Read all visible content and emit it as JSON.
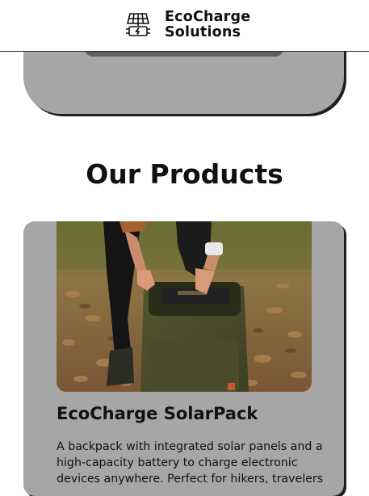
{
  "header": {
    "brand_line1": "EcoCharge",
    "brand_line2": "Solutions",
    "logo_icon": "solar-panel-battery-icon"
  },
  "main": {
    "section_title": "Our Products",
    "products": [
      {
        "name": "EcoCharge SolarPack",
        "image_alt": "Person unzipping an olive backpack with integrated solar panel on a leaf-covered forest path",
        "description": "A backpack with integrated solar panels and a high-capacity battery to charge electronic devices anywhere. Perfect for hikers, travelers"
      }
    ]
  },
  "colors": {
    "card_background": "#a6a6a6",
    "card_shadow": "#1f1f1f",
    "text": "#111111",
    "page_background": "#ffffff"
  }
}
